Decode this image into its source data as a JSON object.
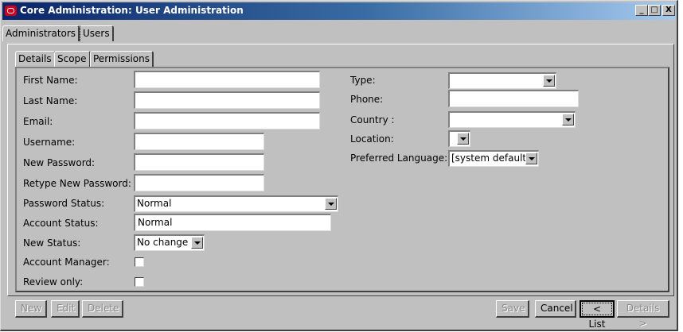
{
  "window": {
    "title": "Core Administration: User Administration",
    "controls": [
      "_",
      "□",
      "X"
    ]
  },
  "top_tabs": [
    {
      "label": "Administrators",
      "active": false
    },
    {
      "label": "Users",
      "active": true
    }
  ],
  "sub_tabs": [
    {
      "label": "Details",
      "active": true
    },
    {
      "label": "Scope",
      "active": false
    },
    {
      "label": "Permissions",
      "active": false
    }
  ],
  "form_left": {
    "first_name": {
      "label": "First Name:",
      "value": ""
    },
    "last_name": {
      "label": "Last Name:",
      "value": ""
    },
    "email": {
      "label": "Email:",
      "value": ""
    },
    "username": {
      "label": "Username:",
      "value": ""
    },
    "new_password": {
      "label": "New Password:",
      "value": ""
    },
    "retype_password": {
      "label": "Retype New Password:",
      "value": ""
    },
    "password_status": {
      "label": "Password Status:",
      "value": "Normal"
    },
    "account_status": {
      "label": "Account Status:",
      "value": "Normal"
    },
    "new_status": {
      "label": "New Status:",
      "value": "No change"
    },
    "account_manager": {
      "label": "Account Manager:",
      "checked": false
    },
    "review_only": {
      "label": "Review only:",
      "checked": false
    }
  },
  "form_right": {
    "type": {
      "label": "Type:",
      "value": ""
    },
    "phone": {
      "label": "Phone:",
      "value": ""
    },
    "country": {
      "label": "Country :",
      "value": ""
    },
    "location": {
      "label": "Location:",
      "value": ""
    },
    "preferred_language": {
      "label": "Preferred Language:",
      "value": "[system default]"
    }
  },
  "buttons": {
    "new": "New",
    "edit": "Edit",
    "delete": "Delete",
    "save": "Save",
    "cancel": "Cancel",
    "list": "< List",
    "details": "Details >"
  },
  "colors": {
    "face": "#c0c0c0",
    "titlebar_start": "#0a246a",
    "titlebar_end": "#a6caf0",
    "logo": "#d0021b"
  }
}
